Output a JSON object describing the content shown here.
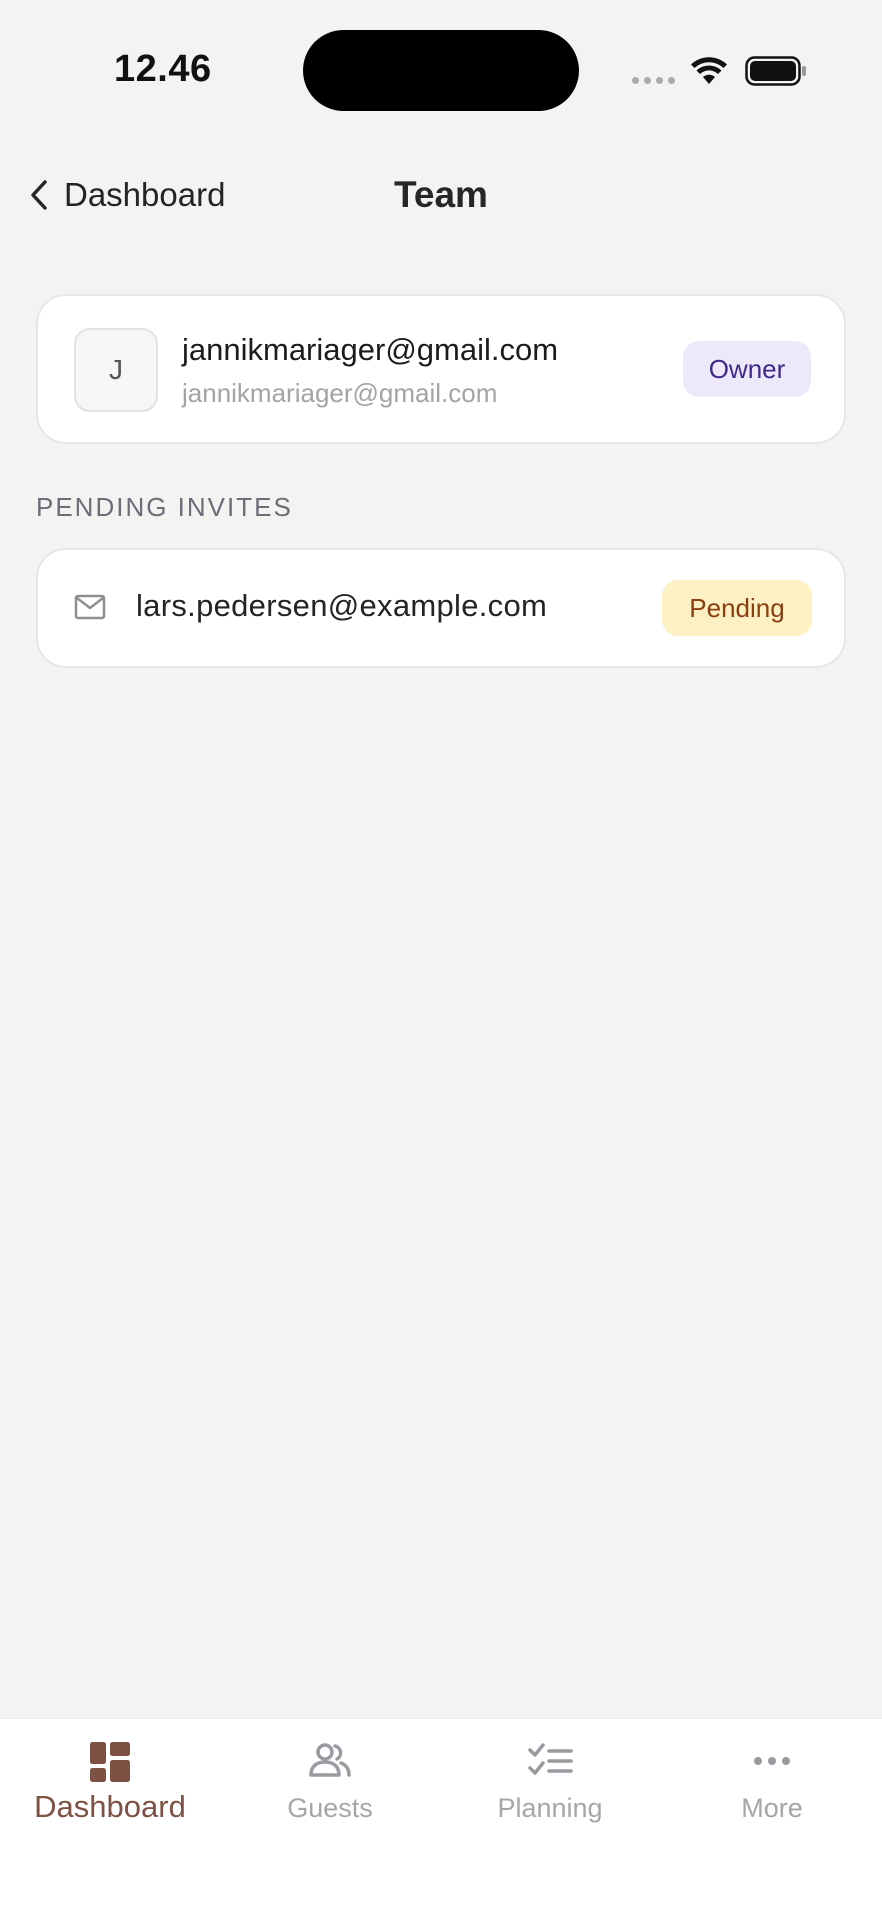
{
  "status_bar": {
    "time": "12.46"
  },
  "nav": {
    "back_label": "Dashboard",
    "title": "Team"
  },
  "member": {
    "avatar_initial": "J",
    "name": "jannikmariager@gmail.com",
    "email": "jannikmariager@gmail.com",
    "role_badge": "Owner"
  },
  "pending_section": {
    "header": "PENDING INVITES",
    "invites": [
      {
        "email": "lars.pedersen@example.com",
        "status": "Pending",
        "icon": "mail-icon"
      }
    ]
  },
  "tab_bar": {
    "active": "Dashboard",
    "tabs": [
      {
        "label": "Dashboard",
        "icon": "dashboard-icon"
      },
      {
        "label": "Guests",
        "icon": "guests-icon"
      },
      {
        "label": "Planning",
        "icon": "planning-icon"
      },
      {
        "label": "More",
        "icon": "more-icon"
      }
    ]
  },
  "colors": {
    "background": "#f4f3f2",
    "card": "#ffffff",
    "owner_badge_bg": "#ede9fb",
    "owner_badge_text": "#3d2a8a",
    "pending_badge_bg": "#fdf1c4",
    "pending_badge_text": "#8a3f10",
    "tab_active": "#7d5144",
    "tab_inactive": "#a6a6aa"
  }
}
